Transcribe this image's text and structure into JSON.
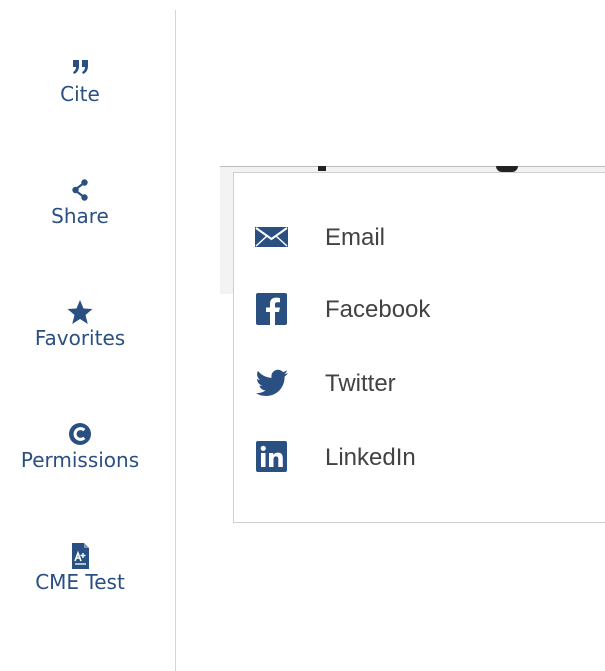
{
  "sidebar": {
    "tools": [
      {
        "label": "Cite",
        "icon": "quote-icon"
      },
      {
        "label": "Share",
        "icon": "share-icon"
      },
      {
        "label": "Favorites",
        "icon": "star-icon"
      },
      {
        "label": "Permissions",
        "icon": "copyright-icon"
      },
      {
        "label": "CME Test",
        "icon": "cme-test-icon"
      }
    ]
  },
  "share_menu": {
    "items": [
      {
        "label": "Email",
        "icon": "email-icon"
      },
      {
        "label": "Facebook",
        "icon": "facebook-icon"
      },
      {
        "label": "Twitter",
        "icon": "twitter-icon"
      },
      {
        "label": "LinkedIn",
        "icon": "linkedin-icon"
      }
    ]
  },
  "colors": {
    "brand_blue": "#2a5082",
    "menu_text": "#424242",
    "divider": "#d6d6d6",
    "popup_border": "#cfcfcf"
  }
}
